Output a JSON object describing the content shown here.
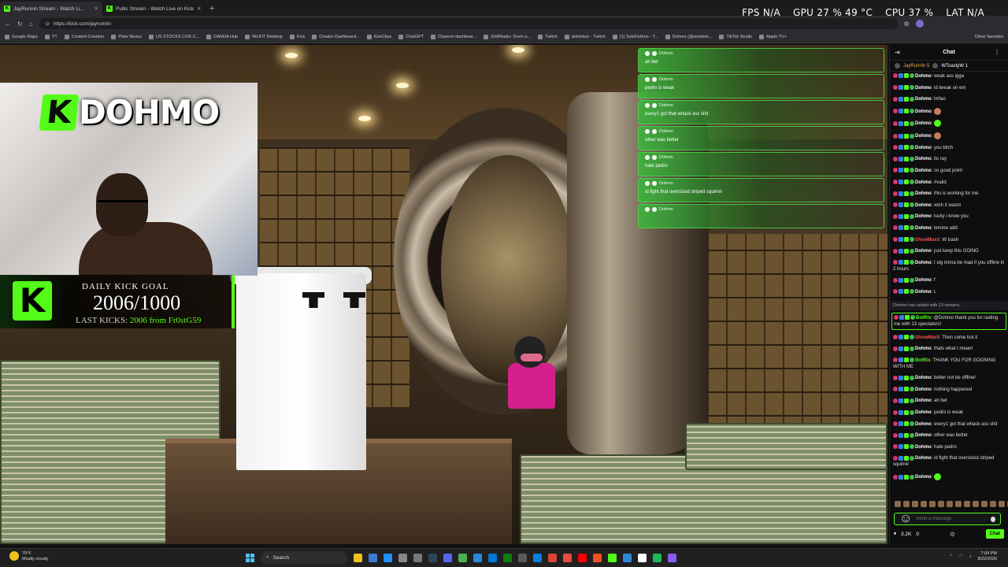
{
  "browser": {
    "tabs": [
      {
        "title": "JayRunnin Stream - Watch Li...",
        "active": true
      },
      {
        "title": "Pullis Stream - Watch Live on Kick",
        "active": false
      }
    ],
    "new_tab": "+",
    "url": "https://kick.com/jayrunnin",
    "bookmarks": [
      "Google Maps",
      "YT",
      "Content Creation",
      "Poke Nexus",
      "US STOCKS LIVE C...",
      "OANDA Hub",
      "IRLKIT Desktop",
      "Kick",
      "Creator Dashboard...",
      "KickClips",
      "ChatGPT",
      "Channel dashboar...",
      "DnBRadio: Drum a...",
      "Twitch",
      "dohmkun - Twitch",
      "(1) SoloDohmo - T...",
      "Dohmo (@solodoh...",
      "TikTok Studio",
      "Apple TV+"
    ],
    "other_favorites": "Other favorites"
  },
  "hud": {
    "fps_label": "FPS",
    "fps_value": "N/A",
    "gpu_label": "GPU",
    "gpu_value": "27 %",
    "gpu_temp": "49 °C",
    "cpu_label": "CPU",
    "cpu_value": "37 %",
    "lat_label": "LAT",
    "lat_value": "N/A"
  },
  "stream": {
    "logo_text": "DOHMO",
    "goal": {
      "title": "DAILY KICK GOAL",
      "value": "2006/1000",
      "last_prefix": "LAST KICKS:",
      "last_value": "2006 from Fr0stG59"
    },
    "overlay_messages": [
      {
        "user": "Dohmo",
        "text": "ah bet"
      },
      {
        "user": "Dohmo",
        "text": "pedro is weak"
      },
      {
        "user": "Dohmo",
        "text": "every1 got that whack ass shit"
      },
      {
        "user": "Dohmo",
        "text": "other was better"
      },
      {
        "user": "Dohmo",
        "text": "hate pedro"
      },
      {
        "user": "Dohmo",
        "text": "id fight that oversized striped squirrel"
      },
      {
        "user": "Dohmo",
        "text": ""
      }
    ]
  },
  "chat": {
    "title": "Chat",
    "pinned": [
      "JayRunnin 5",
      "WToastyW 1"
    ],
    "messages": [
      {
        "user": "Dohmo",
        "text": "weak ass igga",
        "color": "white"
      },
      {
        "user": "Dohmo",
        "text": "id tweak on em",
        "color": "white"
      },
      {
        "user": "Dohmo",
        "text": "lmfao",
        "color": "white"
      },
      {
        "user": "Dohmo",
        "text": "",
        "emote": "face",
        "color": "white"
      },
      {
        "user": "Dohmo",
        "text": "",
        "emote": "green",
        "color": "white"
      },
      {
        "user": "Dohmo",
        "text": "",
        "emote": "face",
        "color": "white"
      },
      {
        "user": "Dohmo",
        "text": "you bitch",
        "color": "white"
      },
      {
        "user": "Dohmo",
        "text": "its ray",
        "color": "white"
      },
      {
        "user": "Dohmo",
        "text": "so good point",
        "color": "white"
      },
      {
        "user": "Dohmo",
        "text": "#valid",
        "color": "white"
      },
      {
        "user": "Dohmo",
        "text": "this is working for me",
        "color": "white"
      },
      {
        "user": "Dohmo",
        "text": "wish it wasnt",
        "color": "white"
      },
      {
        "user": "Dohmo",
        "text": "lucky i know you",
        "color": "white"
      },
      {
        "user": "Dohmo",
        "text": "lemme add",
        "color": "white"
      },
      {
        "user": "ShowMaxli",
        "text": "W trash",
        "color": "red"
      },
      {
        "user": "Dohmo",
        "text": "just keep this GOING",
        "color": "white"
      },
      {
        "user": "Dohmo",
        "text": "I stg imma be mad if you offline in 2 hours",
        "color": "white"
      },
      {
        "user": "Dohmo",
        "text": "f",
        "color": "white"
      },
      {
        "user": "Dohmo",
        "text": "L",
        "color": "white"
      }
    ],
    "raid_notice": "Dohmo has raided with 13 viewers.",
    "bot_highlight": {
      "user": "BotRix",
      "text": "@Dohmo thank you for raiding me with 13 spectators!"
    },
    "messages2": [
      {
        "user": "ShowMaxli",
        "text": "Then come lick it",
        "color": "red"
      },
      {
        "user": "Dohmo",
        "text": "thats what I meant",
        "color": "white"
      },
      {
        "user": "BotRix",
        "text": "THANK YOU FOR GOONING WITH ME",
        "color": "green"
      },
      {
        "user": "Dohmo",
        "text": "better not be offline!",
        "color": "white"
      },
      {
        "user": "Dohmo",
        "text": "nothing happened",
        "color": "white"
      },
      {
        "user": "Dohmo",
        "text": "ah bet",
        "color": "white"
      },
      {
        "user": "Dohmo",
        "text": "pedro is weak",
        "color": "white"
      },
      {
        "user": "Dohmo",
        "text": "every1 got that whack ass shit",
        "color": "white"
      },
      {
        "user": "Dohmo",
        "text": "other was better",
        "color": "white"
      },
      {
        "user": "Dohmo",
        "text": "hate pedro",
        "color": "white"
      },
      {
        "user": "Dohmo",
        "text": "id fight that oversized striped squirrel",
        "color": "white"
      },
      {
        "user": "Dohmo",
        "text": "",
        "emote": "green",
        "color": "white"
      }
    ],
    "input_placeholder": "Send a message",
    "points": "3.2K",
    "zero": "0",
    "send_label": "Chat"
  },
  "taskbar": {
    "temp": "70°F",
    "weather": "Mostly cloudy",
    "search": "Search",
    "time": "7:04 PM",
    "date": "8/22/2026"
  },
  "colors": {
    "kick_green": "#53fc18",
    "chat_bg": "#0e0e10"
  }
}
